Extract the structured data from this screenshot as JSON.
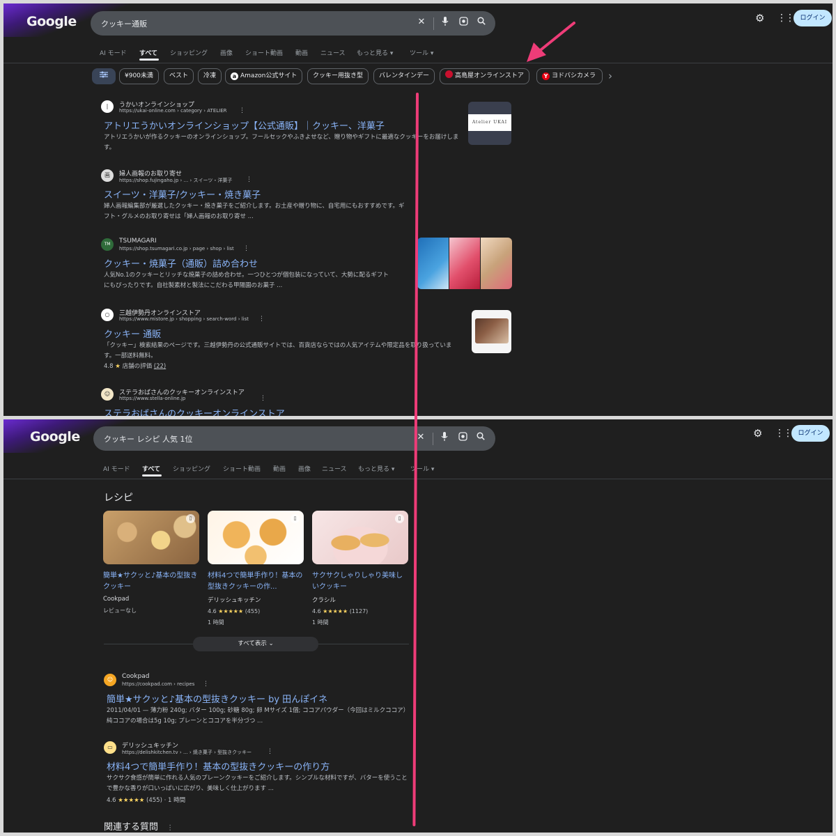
{
  "common": {
    "logo": "Google",
    "login": "ログイン",
    "icons": [
      "clear-icon",
      "mic-icon",
      "lens-icon",
      "search-icon",
      "gear-icon",
      "apps-icon"
    ]
  },
  "top": {
    "query": "クッキー通販",
    "tabs": [
      "AI モード",
      "すべて",
      "ショッピング",
      "画像",
      "ショート動画",
      "動画",
      "ニュース",
      "もっと見る ▾",
      "ツール ▾"
    ],
    "chips": [
      "¥900未満",
      "ベスト",
      "冷凍",
      "Amazon公式サイト",
      "クッキー用抜き型",
      "バレンタインデー",
      "高島屋オンラインストア",
      "ヨドバシカメラ"
    ],
    "results": [
      {
        "site": "うかいオンラインショップ",
        "url": "https://ukai-online.com › category › ATELIER",
        "title": "アトリエうかいオンラインショップ【公式通販】｜クッキー、洋菓子",
        "snippet": "アトリエうかいが作るクッキーのオンラインショップ。フールセックやふきよせなど、贈り物やギフトに最適なクッキーをお届けします。",
        "thumb_text": "Atelier UKAI"
      },
      {
        "site": "婦人画報のお取り寄せ",
        "url": "https://shop.fujingaho.jp › ... › スイーツ・洋菓子",
        "title": "スイーツ・洋菓子/クッキー・焼き菓子",
        "snippet": "婦人画報編集部が厳選したクッキー・焼き菓子をご紹介します。お土産や贈り物に、自宅用にもおすすめです。ギフト・グルメのお取り寄せは「婦人画報のお取り寄せ ..."
      },
      {
        "site": "TSUMAGARI",
        "url": "https://shop.tsumagari.co.jp › page › shop › list",
        "title": "クッキー・焼菓子（通販）詰め合わせ",
        "snippet": "人気No.1のクッキーとリッチな焼菓子の詰め合わせ。一つひとつが個包装になっていて、大勢に配るギフトにもぴったりです。自社製素材と製法にこだわる甲陽園のお菓子 ..."
      },
      {
        "site": "三越伊勢丹オンラインストア",
        "url": "https://www.mistore.jp › shopping › search-word › list",
        "title": "クッキー 通販",
        "snippet": "「クッキー」検索結果のページです。三越伊勢丹の公式通販サイトでは、百貨店ならではの人気アイテムや限定品を取り扱っています。一部送料無料。",
        "rating_value": "4.8",
        "rating_label": "店舗の評価",
        "rating_count": "(22)"
      },
      {
        "site": "ステラおばさんのクッキーオンラインストア",
        "url": "https://www.stella-online.jp",
        "title": "ステラおばさんのクッキーオンラインストア"
      }
    ]
  },
  "bottom": {
    "query": "クッキー レシピ 人気 1位",
    "tabs": [
      "AI モード",
      "すべて",
      "ショッピング",
      "ショート動画",
      "動画",
      "画像",
      "ニュース",
      "もっと見る ▾",
      "ツール ▾"
    ],
    "recipe_heading": "レシピ",
    "recipes": [
      {
        "title": "簡単★サクッと♪基本の型抜きクッキー",
        "source": "Cookpad",
        "meta": "レビューなし",
        "time": ""
      },
      {
        "title": "材料4つで簡単手作り！基本の型抜きクッキーの作...",
        "source": "デリッシュキッチン",
        "meta_value": "4.6",
        "meta_count": "(455)",
        "time": "1 時間"
      },
      {
        "title": "サクサクしゃりしゃり美味しいクッキー",
        "source": "クラシル",
        "meta_value": "4.6",
        "meta_count": "(1127)",
        "time": "1 時間"
      }
    ],
    "show_all": "すべて表示",
    "results": [
      {
        "site": "Cookpad",
        "url": "https://cookpad.com › recipes",
        "title": "簡単★サクッと♪基本の型抜きクッキー by 田んぽイネ",
        "snippet": "2011/04/01 — 薄力粉 240g; バター 100g; 砂糖 80g; 卵 Mサイズ 1個; ココアパウダー（今回はミルクココア）純ココアの場合は5g 10g; プレーンとココアを半分づつ ..."
      },
      {
        "site": "デリッシュキッチン",
        "url": "https://delishkitchen.tv › ... › 焼き菓子 › 型抜きクッキー",
        "title": "材料4つで簡単手作り！基本の型抜きクッキーの作り方",
        "snippet": "サクサク食感が簡単に作れる人気のプレーンクッキーをご紹介します。シンプルな材料ですが、バターを使うことで豊かな香りが口いっぱいに広がり、美味しく仕上がります ...",
        "rating_value": "4.6",
        "rating_count": "(455)",
        "rating_time": "· 1 時間"
      }
    ],
    "related": "関連する質問"
  },
  "annotation": {
    "arrow_color": "#ee3c78",
    "line_color": "#ee3c78"
  }
}
